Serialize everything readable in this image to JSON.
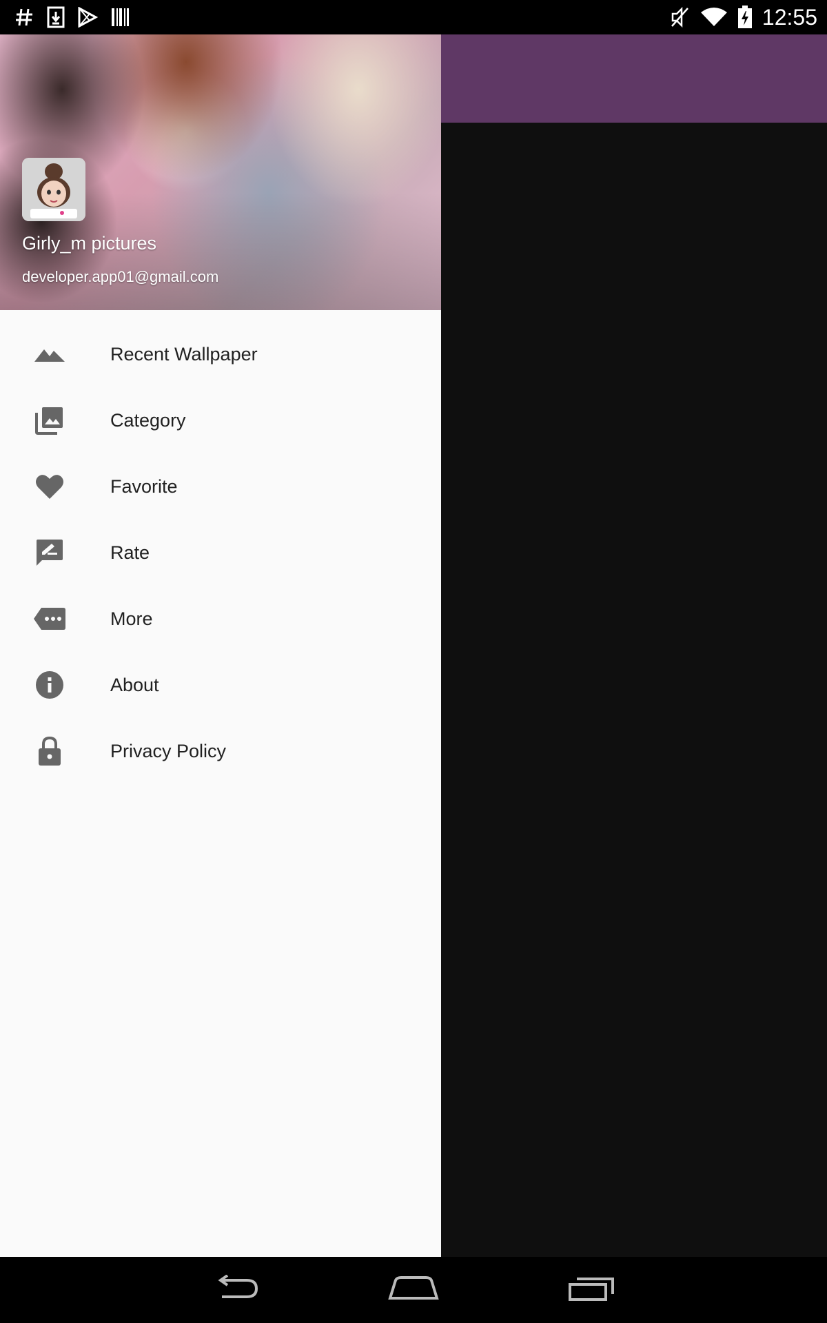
{
  "status_bar": {
    "time": "12:55",
    "left_icons": [
      "hash-icon",
      "download-icon",
      "play-store-icon",
      "barcode-icon"
    ],
    "right_icons": [
      "mute-icon",
      "wifi-icon",
      "battery-charging-icon"
    ]
  },
  "drawer": {
    "header": {
      "title": "Girly_m pictures",
      "email": "developer.app01@gmail.com"
    },
    "items": [
      {
        "label": "Recent Wallpaper",
        "icon": "landscape-icon"
      },
      {
        "label": "Category",
        "icon": "photo-library-icon"
      },
      {
        "label": "Favorite",
        "icon": "heart-icon"
      },
      {
        "label": "Rate",
        "icon": "rate-review-icon"
      },
      {
        "label": "More",
        "icon": "more-tag-icon"
      },
      {
        "label": "About",
        "icon": "info-icon"
      },
      {
        "label": "Privacy Policy",
        "icon": "lock-icon"
      }
    ]
  },
  "colors": {
    "toolbar": "#5f3865",
    "drawer_bg": "#fafafa",
    "icon": "#666666",
    "text": "#212121"
  }
}
